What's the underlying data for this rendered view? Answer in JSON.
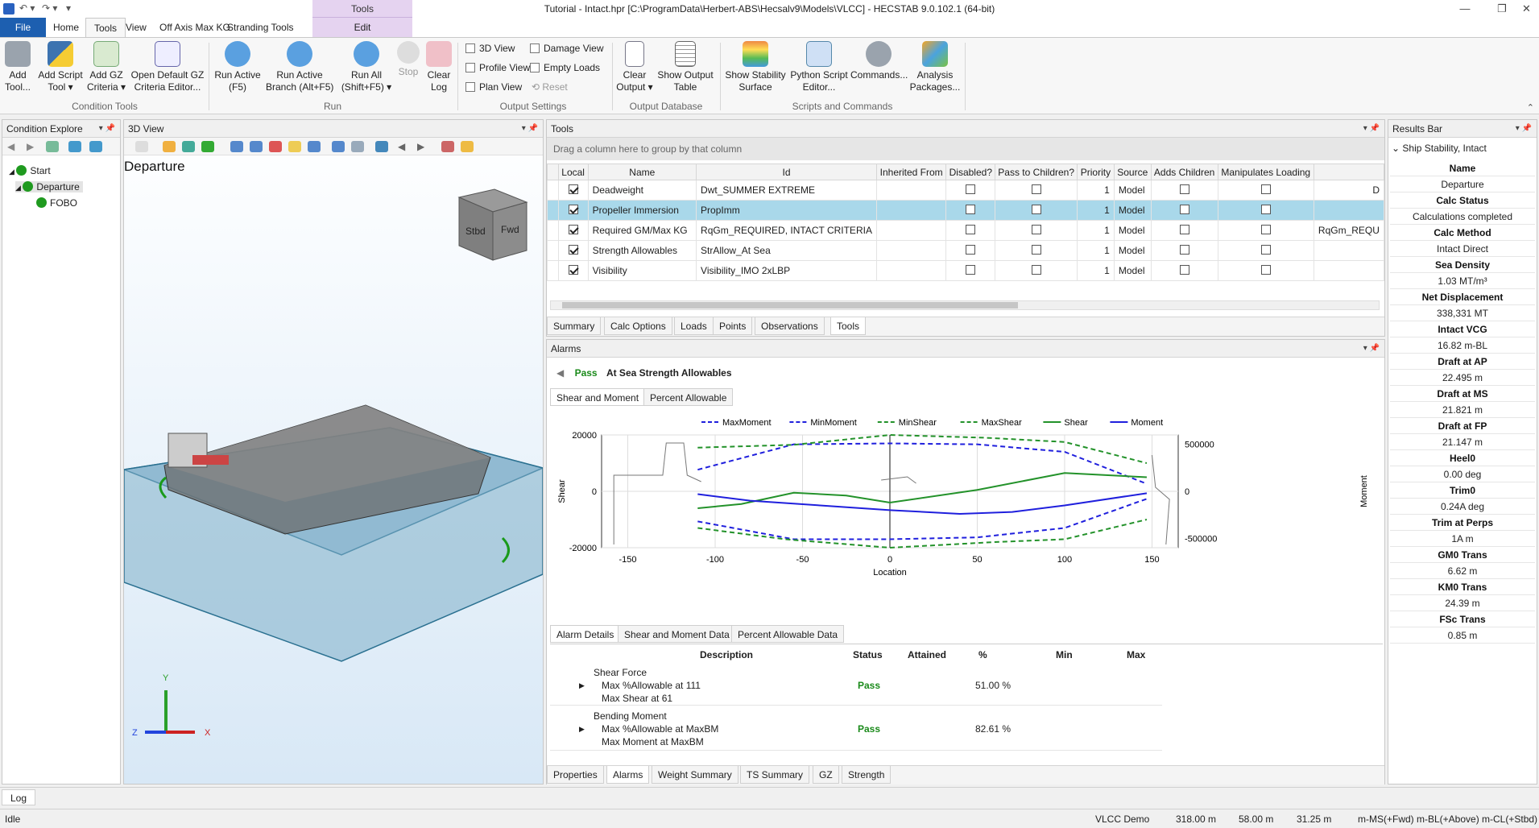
{
  "window": {
    "title": "Tutorial - Intact.hpr [C:\\ProgramData\\Herbert-ABS\\Hecsalv9\\Models\\VLCC] - HECSTAB 9.0.102.1 (64-bit)",
    "context_group": "Tools",
    "context_tab": "Edit"
  },
  "ribbon_tabs": [
    "File",
    "Home",
    "Tools",
    "View",
    "Off Axis Max KG",
    "Stranding Tools"
  ],
  "ribbon": {
    "condition_tools": {
      "label": "Condition Tools",
      "buttons": [
        "Add\nTool...",
        "Add Script\nTool ▾",
        "Add GZ\nCriteria ▾",
        "Open Default GZ\nCriteria Editor..."
      ]
    },
    "run": {
      "label": "Run",
      "buttons": [
        "Run Active\n(F5)",
        "Run Active\nBranch (Alt+F5)",
        "Run All\n(Shift+F5) ▾",
        "Stop",
        "Clear\nLog"
      ]
    },
    "output_settings": {
      "label": "Output Settings",
      "options": [
        "3D View",
        "Profile View",
        "Plan View",
        "Damage View",
        "Empty Loads",
        "Reset"
      ]
    },
    "output_database": {
      "label": "Output Database",
      "buttons": [
        "Clear\nOutput ▾",
        "Show Output\nTable"
      ]
    },
    "scripts": {
      "label": "Scripts and Commands",
      "buttons": [
        "Show Stability\nSurface",
        "Python Script\nEditor...",
        "Commands...",
        "Analysis\nPackages..."
      ]
    }
  },
  "condition_explorer": {
    "title": "Condition Explore",
    "items": [
      "Start",
      "Departure",
      "FOBO"
    ]
  },
  "view3d": {
    "title": "3D View",
    "condition": "Departure",
    "cube_stbd": "Stbd",
    "cube_fwd": "Fwd",
    "axis_x": "X",
    "axis_y": "Y",
    "axis_z": "Z"
  },
  "tools": {
    "title": "Tools",
    "group_hint": "Drag a column here to group by that column",
    "columns": [
      "Local",
      "Name",
      "Id",
      "Inherited From",
      "Disabled?",
      "Pass to Children?",
      "Priority",
      "Source",
      "Adds Children",
      "Manipulates Loading"
    ],
    "rows": [
      {
        "local": true,
        "name": "Deadweight",
        "id": "Dwt_SUMMER EXTREME",
        "priority": "1",
        "source": "Model",
        "extra": "D"
      },
      {
        "local": true,
        "name": "Propeller Immersion",
        "id": "PropImm",
        "priority": "1",
        "source": "Model",
        "extra": ""
      },
      {
        "local": true,
        "name": "Required GM/Max KG",
        "id": "RqGm_REQUIRED, INTACT CRITERIA",
        "priority": "1",
        "source": "Model",
        "extra": "RqGm_REQU"
      },
      {
        "local": true,
        "name": "Strength Allowables",
        "id": "StrAllow_At Sea",
        "priority": "1",
        "source": "Model",
        "extra": ""
      },
      {
        "local": true,
        "name": "Visibility",
        "id": "Visibility_IMO 2xLBP",
        "priority": "1",
        "source": "Model",
        "extra": ""
      }
    ],
    "tabs": [
      "Summary",
      "Calc Options",
      "Loads",
      "Points",
      "Observations",
      "Tools"
    ]
  },
  "alarms": {
    "title": "Alarms",
    "status": "Pass",
    "alarm_name": "At Sea Strength Allowables",
    "chart_tabs": [
      "Shear and Moment",
      "Percent Allowable"
    ],
    "detail_tabs": [
      "Alarm Details",
      "Shear and Moment Data",
      "Percent Allowable Data"
    ],
    "detail_columns": [
      "Description",
      "Status",
      "Attained",
      "%",
      "Min",
      "Max"
    ],
    "details": [
      {
        "title": "Shear Force",
        "line1": "Max %Allowable at 111",
        "line2": "Max Shear at 61",
        "status": "Pass",
        "pct": "51.00 %"
      },
      {
        "title": "Bending Moment",
        "line1": "Max %Allowable at MaxBM",
        "line2": "Max Moment at MaxBM",
        "status": "Pass",
        "pct": "82.61 %"
      }
    ],
    "bottom_tabs": [
      "Properties",
      "Alarms",
      "Weight Summary",
      "TS Summary",
      "GZ",
      "Strength"
    ]
  },
  "chart_data": {
    "type": "line",
    "xlabel": "Location",
    "ylabel": "Shear",
    "y2label": "Moment",
    "xlim": [
      -165,
      165
    ],
    "ylim": [
      -20000,
      20000
    ],
    "y2lim": [
      -600000,
      600000
    ],
    "xticks": [
      -150,
      -100,
      -50,
      0,
      50,
      100,
      150
    ],
    "yticks": [
      -20000,
      0,
      20000
    ],
    "y2ticks": [
      -500000,
      0,
      500000
    ],
    "grid": true,
    "legend": "top",
    "series": [
      {
        "name": "MaxMoment",
        "axis": "y2",
        "style": "dash",
        "color": "#1f1fdd",
        "x": [
          -110,
          -55,
          0,
          50,
          100,
          147
        ],
        "values": [
          230000,
          500000,
          510000,
          500000,
          420000,
          80000
        ]
      },
      {
        "name": "MinMoment",
        "axis": "y2",
        "style": "dash",
        "color": "#1f1fdd",
        "x": [
          -110,
          -55,
          0,
          50,
          100,
          147
        ],
        "values": [
          -320000,
          -510000,
          -510000,
          -490000,
          -390000,
          -80000
        ]
      },
      {
        "name": "MinShear",
        "axis": "y",
        "style": "dash",
        "color": "#23922a",
        "x": [
          -110,
          -60,
          0,
          60,
          100,
          147
        ],
        "values": [
          -13000,
          -17000,
          -20000,
          -18000,
          -17000,
          -10000
        ]
      },
      {
        "name": "MaxShear",
        "axis": "y",
        "style": "dash",
        "color": "#23922a",
        "x": [
          -110,
          -55,
          0,
          55,
          100,
          147
        ],
        "values": [
          15500,
          16500,
          20000,
          19000,
          17500,
          10000
        ]
      },
      {
        "name": "Shear",
        "axis": "y",
        "style": "solid",
        "color": "#23922a",
        "x": [
          -110,
          -85,
          -55,
          -25,
          0,
          50,
          100,
          147
        ],
        "values": [
          -6000,
          -4500,
          -500,
          -1500,
          -4000,
          500,
          6500,
          5000
        ]
      },
      {
        "name": "Moment",
        "axis": "y2",
        "style": "solid",
        "color": "#1f1fdd",
        "x": [
          -110,
          -80,
          -40,
          0,
          40,
          70,
          100,
          147
        ],
        "values": [
          -30000,
          -100000,
          -150000,
          -200000,
          -240000,
          -220000,
          -150000,
          -20000
        ]
      }
    ]
  },
  "results": {
    "title": "Results Bar",
    "section": "Ship Stability, Intact",
    "items": [
      {
        "label": "Name",
        "value": "Departure"
      },
      {
        "label": "Calc Status",
        "value": "Calculations completed"
      },
      {
        "label": "Calc Method",
        "value": "Intact Direct"
      },
      {
        "label": "Sea Density",
        "value": "1.03 MT/m³"
      },
      {
        "label": "Net Displacement",
        "value": "338,331 MT"
      },
      {
        "label": "Intact VCG",
        "value": "16.82 m-BL"
      },
      {
        "label": "Draft at AP",
        "value": "22.495 m"
      },
      {
        "label": "Draft at MS",
        "value": "21.821 m"
      },
      {
        "label": "Draft at FP",
        "value": "21.147 m"
      },
      {
        "label": "Heel0",
        "value": "0.00 deg"
      },
      {
        "label": "Trim0",
        "value": "0.24A deg"
      },
      {
        "label": "Trim at Perps",
        "value": "1A m"
      },
      {
        "label": "GM0 Trans",
        "value": "6.62 m"
      },
      {
        "label": "KM0 Trans",
        "value": "24.39 m"
      },
      {
        "label": "FSc Trans",
        "value": "0.85 m"
      }
    ]
  },
  "log": {
    "tab": "Log"
  },
  "status": {
    "left": "Idle",
    "model": "VLCC Demo",
    "length": "318.00 m",
    "breadth": "58.00 m",
    "depth": "31.25 m",
    "coords": "m-MS(+Fwd)  m-BL(+Above)  m-CL(+Stbd)"
  }
}
